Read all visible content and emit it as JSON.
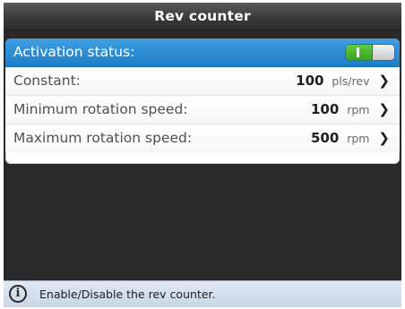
{
  "window": {
    "title": "Rev counter"
  },
  "settings": {
    "activation": {
      "label": "Activation status:",
      "toggle_state": "on",
      "toggle_on_glyph": "I"
    },
    "rows": [
      {
        "label": "Constant:",
        "value": "100",
        "unit": "pls/rev",
        "chevron": "❯"
      },
      {
        "label": "Minimum rotation speed:",
        "value": "100",
        "unit": "rpm",
        "chevron": "❯"
      },
      {
        "label": "Maximum rotation speed:",
        "value": "500",
        "unit": "rpm",
        "chevron": "❯"
      }
    ]
  },
  "statusbar": {
    "icon": "info-icon",
    "icon_glyph": "i",
    "text": "Enable/Disable the rev counter."
  },
  "colors": {
    "selection": "#2d8ed8",
    "toggle_on": "#4bb52e",
    "background": "#2a2a2a"
  }
}
